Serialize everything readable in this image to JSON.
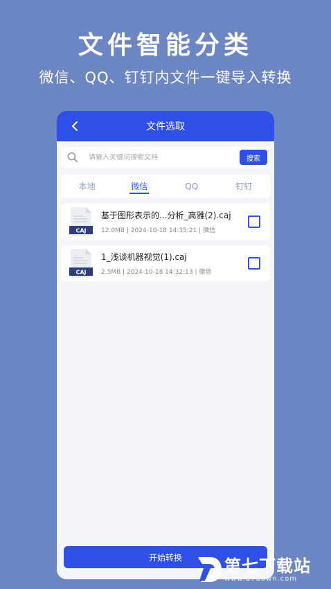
{
  "headline": "文件智能分类",
  "subline": "微信、QQ、钉钉内文件一键导入转换",
  "app": {
    "title": "文件选取",
    "search": {
      "placeholder": "请输入关键词搜索文档",
      "button": "搜索"
    },
    "tabs": [
      {
        "label": "本地",
        "active": false
      },
      {
        "label": "微信",
        "active": true
      },
      {
        "label": "QQ",
        "active": false
      },
      {
        "label": "钉钉",
        "active": false
      }
    ],
    "files": [
      {
        "icon": "caj-file-icon",
        "badge": "CAJ",
        "name": "基于图形表示的...分析_高雅(2).caj",
        "meta": "12.0MB | 2024-10-18 14:35:21 | 微信",
        "checked": false
      },
      {
        "icon": "caj-file-icon",
        "badge": "CAJ",
        "name": "1_浅谈机器视觉(1).caj",
        "meta": "2.5MB | 2024-10-18 14:32:13 | 微信",
        "checked": false
      }
    ],
    "start_button": "开始转换"
  },
  "watermark": {
    "logo_icon": "d7-logo-icon",
    "main": "第七下载站",
    "sub": "www.d7down.com"
  },
  "colors": {
    "background": "#6b86c2",
    "accent": "#2f50e6",
    "caj_badge": "#2c3f7a"
  }
}
